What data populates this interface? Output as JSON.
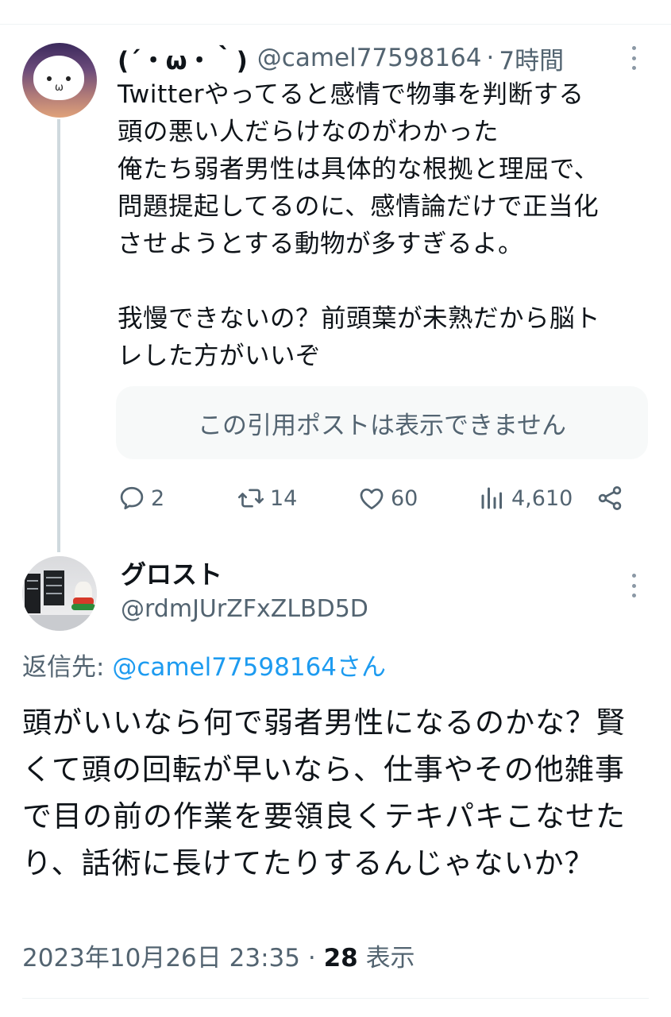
{
  "parent_tweet": {
    "display_name": "(´・ω・｀)",
    "handle": "@camel77598164",
    "separator": "·",
    "time": "7時間",
    "body": "Twitterやってると感情で物事を判断する\n頭の悪い人だらけなのがわかった\n俺たち弱者男性は具体的な根拠と理屈で、\n問題提起してるのに、感情論だけで正当化\nさせようとする動物が多すぎるよ。\n\n我慢できないの？前頭葉が未熟だから脳ト\nレした方がいいぞ",
    "quote_unavailable": "この引用ポストは表示できません",
    "reply_count": "2",
    "repost_count": "14",
    "like_count": "60",
    "view_count": "4,610"
  },
  "reply_tweet": {
    "display_name": "グロスト",
    "handle": "@rdmJUrZFxZLBD5D",
    "replying_label": "返信先:",
    "replying_to": "@camel77598164さん",
    "body": "頭がいいなら何で弱者男性になるのかな？賢くて頭の回転が早いなら、仕事やその他雑事で目の前の作業を要領良くテキパキこなせたり、話術に長けてたりするんじゃないか？",
    "timestamp": "2023年10月26日 23:35",
    "separator": "·",
    "view_count": "28",
    "views_label": "表示"
  },
  "colors": {
    "text": "#0f1419",
    "secondary": "#536471",
    "link": "#1d9bf0",
    "thread_line": "#cfd9de",
    "quote_bg": "#f7f9f9"
  },
  "icons": [
    "more-icon",
    "reply-icon",
    "repost-icon",
    "like-icon",
    "views-icon",
    "share-icon"
  ]
}
